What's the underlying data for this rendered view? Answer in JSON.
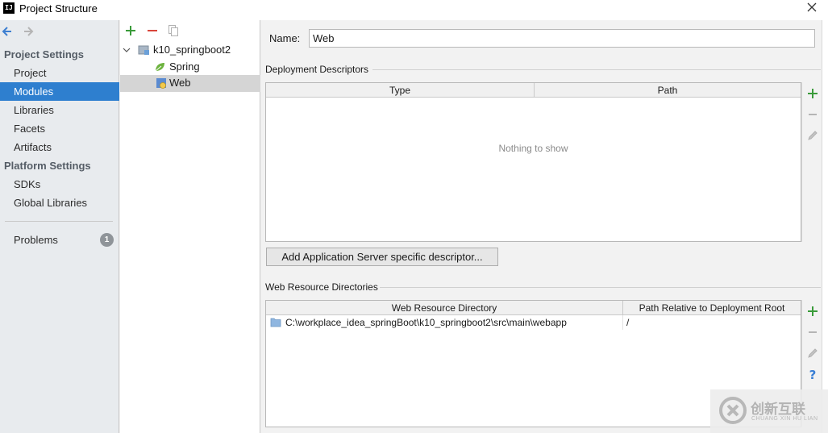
{
  "window": {
    "title": "Project Structure",
    "logo_text": "IJ"
  },
  "nav": {
    "project_settings_heading": "Project Settings",
    "project_settings_items": [
      "Project",
      "Modules",
      "Libraries",
      "Facets",
      "Artifacts"
    ],
    "selected_item": "Modules",
    "platform_settings_heading": "Platform Settings",
    "platform_settings_items": [
      "SDKs",
      "Global Libraries"
    ],
    "problems_label": "Problems",
    "problems_count": "1"
  },
  "tree": {
    "root": "k10_springboot2",
    "children": [
      "Spring",
      "Web"
    ],
    "selected": "Web"
  },
  "detail": {
    "name_label": "Name:",
    "name_value": "Web",
    "deployment_descriptors": {
      "title": "Deployment Descriptors",
      "columns": [
        "Type",
        "Path"
      ],
      "empty_text": "Nothing to show",
      "add_button_label": "Add Application Server specific descriptor..."
    },
    "web_resource_directories": {
      "title": "Web Resource Directories",
      "columns": [
        "Web Resource Directory",
        "Path Relative to Deployment Root"
      ],
      "rows": [
        {
          "directory": "C:\\workplace_idea_springBoot\\k10_springboot2\\src\\main\\webapp",
          "path": "/"
        }
      ]
    }
  },
  "watermark": {
    "brand_cn": "创新互联",
    "brand_pinyin": "CHUANG XIN HU LIAN"
  },
  "colors": {
    "selection": "#2e7fcf",
    "add_green": "#3a9b3a",
    "remove_red": "#d9453b",
    "help_blue": "#3a7fd5"
  }
}
